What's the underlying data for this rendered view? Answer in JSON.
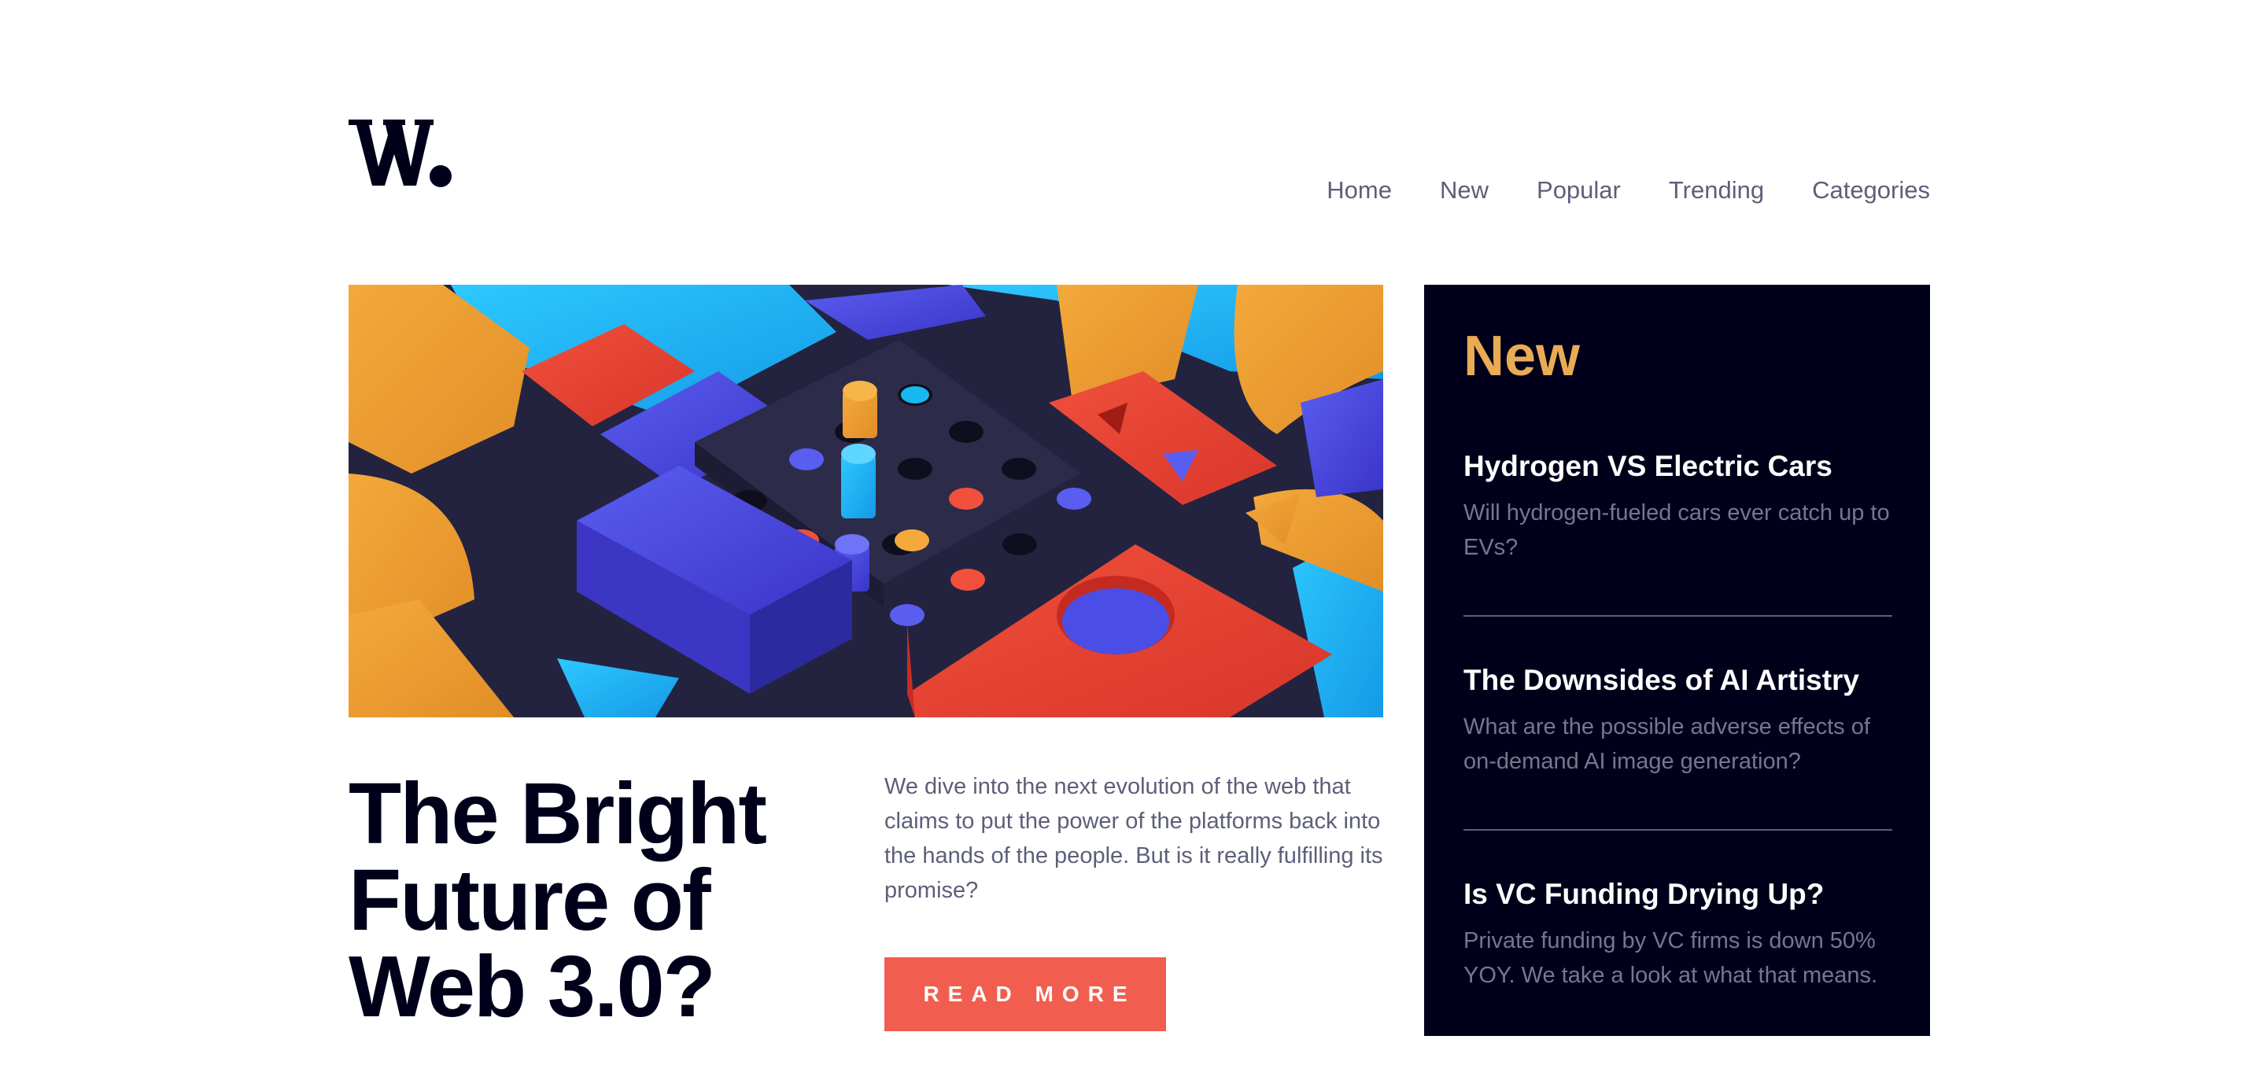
{
  "logo": {
    "alt": "W."
  },
  "nav": {
    "items": [
      {
        "label": "Home"
      },
      {
        "label": "New"
      },
      {
        "label": "Popular"
      },
      {
        "label": "Trending"
      },
      {
        "label": "Categories"
      }
    ]
  },
  "hero": {
    "title_line1": "The Bright",
    "title_line2": "Future of",
    "title_line3": "Web 3.0?",
    "description": "We dive into the next evolution of the web that claims to put the power of the platforms back into the hands of the people. But is it really fulfilling its promise?",
    "button_label": "READ MORE"
  },
  "sidebar": {
    "heading": "New",
    "items": [
      {
        "title": "Hydrogen VS Electric Cars",
        "summary": "Will hydrogen-fueled cars ever catch up to EVs?"
      },
      {
        "title": "The Downsides of AI Artistry",
        "summary": "What are the possible adverse effects of on-demand AI image generation?"
      },
      {
        "title": "Is VC Funding Drying Up?",
        "summary": "Private funding by VC firms is down 50% YOY. We take a look at what that means."
      }
    ]
  },
  "colors": {
    "dark_navy": "#00001a",
    "accent_red": "#f15e50",
    "accent_orange": "#e9ab53",
    "grayish_blue": "#5d5f79"
  }
}
